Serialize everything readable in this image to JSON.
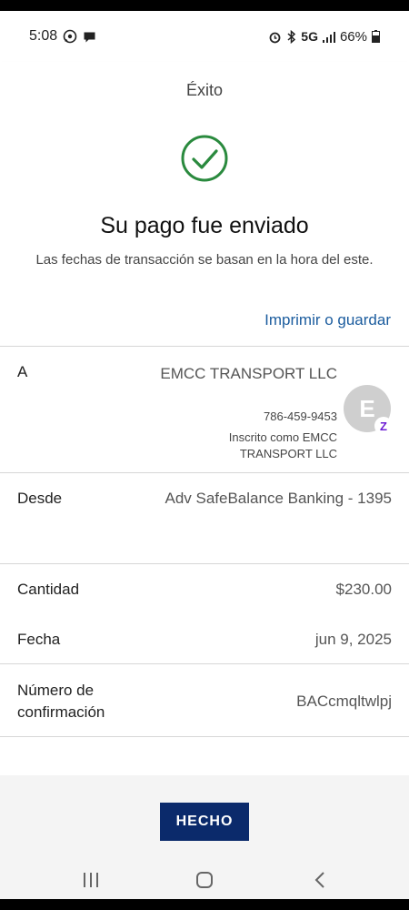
{
  "status_bar": {
    "time": "5:08",
    "network": "5G",
    "battery": "66%"
  },
  "header": {
    "title": "Éxito"
  },
  "confirmation": {
    "title": "Su pago fue enviado",
    "subtitle": "Las fechas de transacción se basan en la hora del este.",
    "print_link": "Imprimir o guardar"
  },
  "details": {
    "to_label": "A",
    "payee_name": "EMCC TRANSPORT LLC",
    "payee_phone": "786-459-9453",
    "payee_enrolled": "Inscrito como EMCC TRANSPORT LLC",
    "payee_initial": "E",
    "from_label": "Desde",
    "from_value": "Adv SafeBalance Banking - 1395",
    "amount_label": "Cantidad",
    "amount_value": "$230.00",
    "date_label": "Fecha",
    "date_value": "jun 9, 2025",
    "confirmation_label": "Número de confirmación",
    "confirmation_value": "BACcmqltwlpj"
  },
  "footer": {
    "done_label": "HECHO"
  },
  "colors": {
    "success_green": "#2a8a3e",
    "link_blue": "#1b5c9e",
    "button_navy": "#0b2a6b",
    "zelle_purple": "#6d1ed4"
  },
  "icons": [
    "whatsapp-icon",
    "chat-icon",
    "alarm-icon",
    "bluetooth-icon",
    "signal-icon",
    "battery-icon",
    "check-circle-icon",
    "zelle-icon",
    "recents-icon",
    "home-icon",
    "back-icon"
  ]
}
